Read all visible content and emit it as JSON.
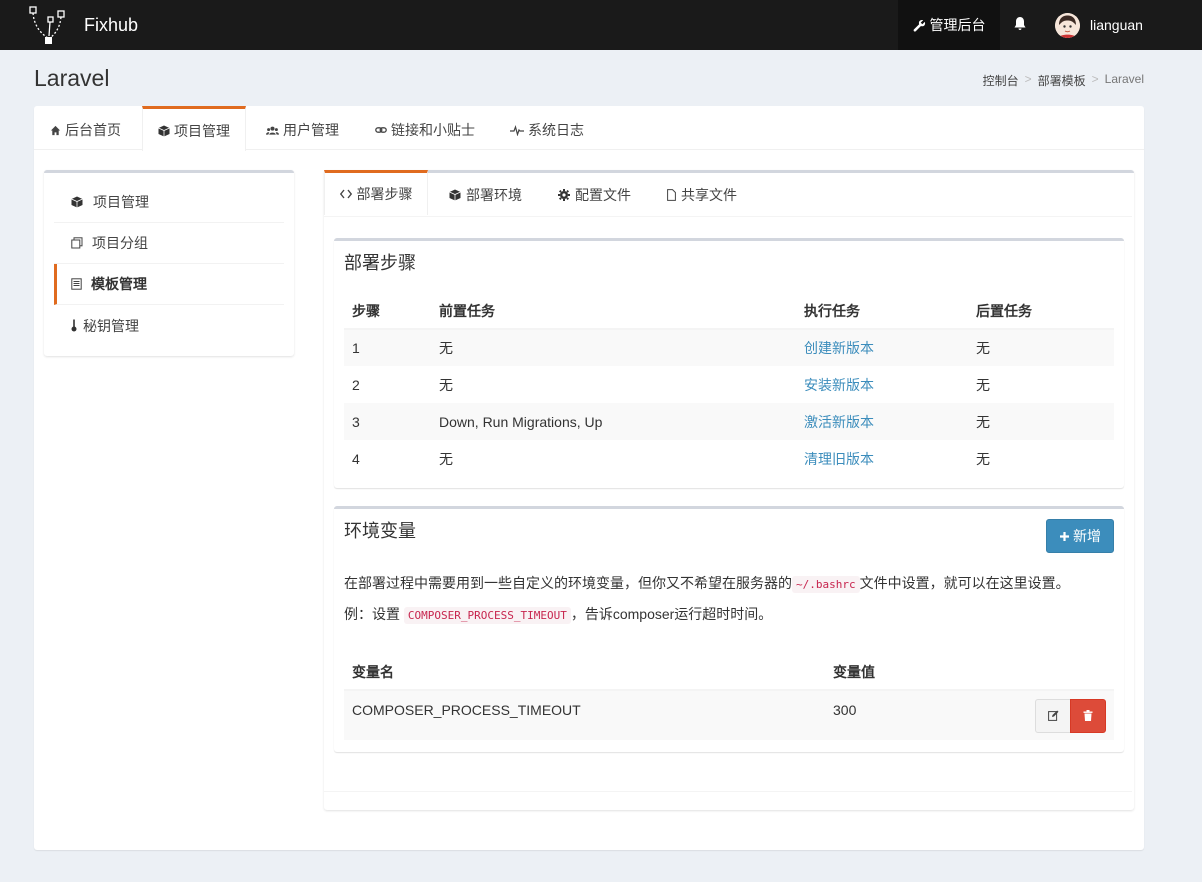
{
  "app": {
    "brand": "Fixhub"
  },
  "topbar": {
    "admin_label": "管理后台",
    "username": "lianguan"
  },
  "page": {
    "title": "Laravel"
  },
  "breadcrumb": {
    "items": [
      "控制台",
      "部署模板",
      "Laravel"
    ]
  },
  "main_tabs": [
    {
      "label": "后台首页",
      "icon": "home-icon"
    },
    {
      "label": "项目管理",
      "icon": "cube-icon",
      "active": true
    },
    {
      "label": "用户管理",
      "icon": "users-icon"
    },
    {
      "label": "链接和小贴士",
      "icon": "link-icon"
    },
    {
      "label": "系统日志",
      "icon": "heartbeat-icon"
    }
  ],
  "sidebar": {
    "items": [
      {
        "label": "项目管理",
        "icon": "cube-icon"
      },
      {
        "label": "项目分组",
        "icon": "clone-icon"
      },
      {
        "label": "模板管理",
        "icon": "file-text-icon",
        "active": true
      },
      {
        "label": "秘钥管理",
        "icon": "key-icon"
      }
    ]
  },
  "sub_tabs": [
    {
      "label": "部署步骤",
      "icon": "code-icon",
      "active": true
    },
    {
      "label": "部署环境",
      "icon": "cube-icon"
    },
    {
      "label": "配置文件",
      "icon": "cog-icon"
    },
    {
      "label": "共享文件",
      "icon": "file-icon"
    }
  ],
  "steps_box": {
    "title": "部署步骤",
    "headers": [
      "步骤",
      "前置任务",
      "执行任务",
      "后置任务"
    ],
    "rows": [
      {
        "step": "1",
        "before": "无",
        "action": "创建新版本",
        "after": "无"
      },
      {
        "step": "2",
        "before": "无",
        "action": "安装新版本",
        "after": "无"
      },
      {
        "step": "3",
        "before": "Down, Run Migrations, Up",
        "action": "激活新版本",
        "after": "无"
      },
      {
        "step": "4",
        "before": "无",
        "action": "清理旧版本",
        "after": "无"
      }
    ]
  },
  "env_box": {
    "title": "环境变量",
    "add_label": "新增",
    "desc_1_a": "在部署过程中需要用到一些自定义的环境变量，但你又不希望在服务器的",
    "desc_1_code": "~/.bashrc",
    "desc_1_b": "文件中设置，就可以在这里设置。",
    "desc_2_a": "例：设置",
    "desc_2_code": "COMPOSER_PROCESS_TIMEOUT",
    "desc_2_b": "，告诉composer运行超时时间。",
    "headers": [
      "变量名",
      "变量值"
    ],
    "rows": [
      {
        "name": "COMPOSER_PROCESS_TIMEOUT",
        "value": "300"
      }
    ]
  },
  "colors": {
    "accent": "#e06b1f",
    "primary": "#3c8dbc",
    "danger": "#dd4b39",
    "topbar": "#1a1a1a",
    "background": "#ecf0f5"
  }
}
